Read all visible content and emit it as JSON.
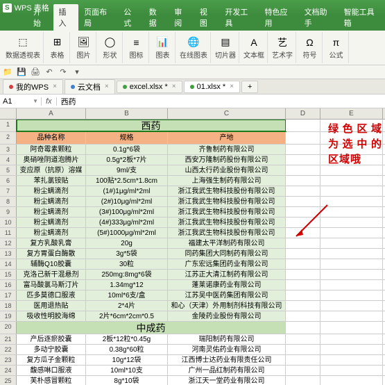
{
  "app": {
    "logo": "S",
    "name": "WPS 表格",
    "dropdown": "▾"
  },
  "ribbonTabs": [
    "开始",
    "插入",
    "页面布局",
    "公式",
    "数据",
    "审阅",
    "视图",
    "开发工具",
    "特色应用",
    "文档助手",
    "智能工具箱"
  ],
  "ribbonActive": 1,
  "ribbonGroups": [
    {
      "icon": "⬚",
      "label": "数据透视表"
    },
    {
      "icon": "⊞",
      "label": "表格"
    },
    {
      "icon": "🖼",
      "label": "图片"
    },
    {
      "icon": "◯",
      "label": "形状"
    },
    {
      "icon": "≡",
      "label": "图标"
    },
    {
      "icon": "📊",
      "label": "图表"
    },
    {
      "icon": "🌐",
      "label": "在线图表"
    },
    {
      "icon": "▤",
      "label": "切片器"
    },
    {
      "icon": "A",
      "label": "文本框"
    },
    {
      "icon": "艺",
      "label": "艺术字"
    },
    {
      "icon": "Ω",
      "label": "符号"
    },
    {
      "icon": "π",
      "label": "公式"
    }
  ],
  "qat": [
    "📁",
    "💾",
    "🖨",
    "↶",
    "↷",
    "▾"
  ],
  "docTabs": [
    {
      "label": "我的WPS",
      "color": "#d04040",
      "close": "×"
    },
    {
      "label": "云文档",
      "color": "#4080d0",
      "close": "×"
    },
    {
      "label": "excel.xlsx *",
      "color": "#40a040",
      "close": "×"
    },
    {
      "label": "01.xlsx *",
      "color": "#40a040",
      "close": "×",
      "active": true
    }
  ],
  "addTab": "+",
  "nameBox": "A1",
  "fxLabel": "fx",
  "formulaValue": "西药",
  "cols": [
    "A",
    "B",
    "C",
    "D",
    "E"
  ],
  "section1": {
    "title": "西药",
    "headers": [
      "品种名称",
      "规格",
      "产地"
    ]
  },
  "rows1": [
    {
      "n": "3",
      "a": "阿奇霉素颗粒",
      "b": "0.1g*6袋",
      "c": "齐鲁制药有限公司"
    },
    {
      "n": "4",
      "a": "奥硝唑阴道泡腾片",
      "b": "0.5g*2板*7片",
      "c": "西安万隆制药股份有限公司"
    },
    {
      "n": "5",
      "a": "变应原（抗原）溶媒",
      "b": "9ml/支",
      "c": "山西太行药业股份有限公司"
    },
    {
      "n": "6",
      "a": "苯扎氯铵贴",
      "b": "100贴*2.5cm*1.8cm",
      "c": "上海强生制药有限公司"
    },
    {
      "n": "7",
      "a": "粉尘螨滴剂",
      "b": "(1#)1μg/ml*2ml",
      "c": "浙江我武生物科技股份有限公司"
    },
    {
      "n": "8",
      "a": "粉尘螨滴剂",
      "b": "(2#)10μg/ml*2ml",
      "c": "浙江我武生物科技股份有限公司"
    },
    {
      "n": "9",
      "a": "粉尘螨滴剂",
      "b": "(3#)100μg/ml*2ml",
      "c": "浙江我武生物科技股份有限公司"
    },
    {
      "n": "10",
      "a": "粉尘螨滴剂",
      "b": "(4#)333μg/ml*2ml",
      "c": "浙江我武生物科技股份有限公司"
    },
    {
      "n": "11",
      "a": "粉尘螨滴剂",
      "b": "(5#)1000μg/ml*2ml",
      "c": "浙江我武生物科技股份有限公司"
    },
    {
      "n": "12",
      "a": "复方乳酸乳膏",
      "b": "20g",
      "c": "福建太平洋制药有限公司"
    },
    {
      "n": "13",
      "a": "复方胃蛋白酶散",
      "b": "3g*5袋",
      "c": "同药集团大同制药有限公司"
    },
    {
      "n": "14",
      "a": "辅酶Q10胶囊",
      "b": "30粒",
      "c": "广东宏远集团药业有限公司"
    },
    {
      "n": "15",
      "a": "克洛己新干混悬剂",
      "b": "250mg:8mg*6袋",
      "c": "江苏正大清江制药有限公司"
    },
    {
      "n": "16",
      "a": "富马酸氯马斯汀片",
      "b": "1.34mg*12",
      "c": "蓬莱诺康药业有限公司"
    },
    {
      "n": "17",
      "a": "匹多莫德口服液",
      "b": "10ml*6支/盒",
      "c": "江苏吴中医药集团有限公司"
    },
    {
      "n": "18",
      "a": "医用退热贴",
      "b": "2*4片",
      "c": "和心（天津）外用制剂科技有限公司"
    },
    {
      "n": "19",
      "a": "吸收性明胶海绵",
      "b": "2片*6cm*2cm*0.5",
      "c": "金陵药业股份有限公司"
    }
  ],
  "section2": {
    "title": "中成药"
  },
  "rows2": [
    {
      "n": "21",
      "a": "产后逐瘀胶囊",
      "b": "2板*12粒*0.45g",
      "c": "瑞阳制药有限公司"
    },
    {
      "n": "22",
      "a": "多动宁胶囊",
      "b": "0.38g*60粒",
      "c": "河南灵佑药业有限公司"
    },
    {
      "n": "23",
      "a": "复方瓜子金颗粒",
      "b": "10g*12袋",
      "c": "江西博士达药业有限责任公司"
    },
    {
      "n": "24",
      "a": "馥感啉口服液",
      "b": "10ml*10支",
      "c": "广州一品红制药有限公司"
    },
    {
      "n": "25",
      "a": "芙朴感冒颗粒",
      "b": "8g*10袋",
      "c": "浙江天一堂药业有限公司"
    }
  ],
  "annotation": "绿色区域为选中的区域哦"
}
